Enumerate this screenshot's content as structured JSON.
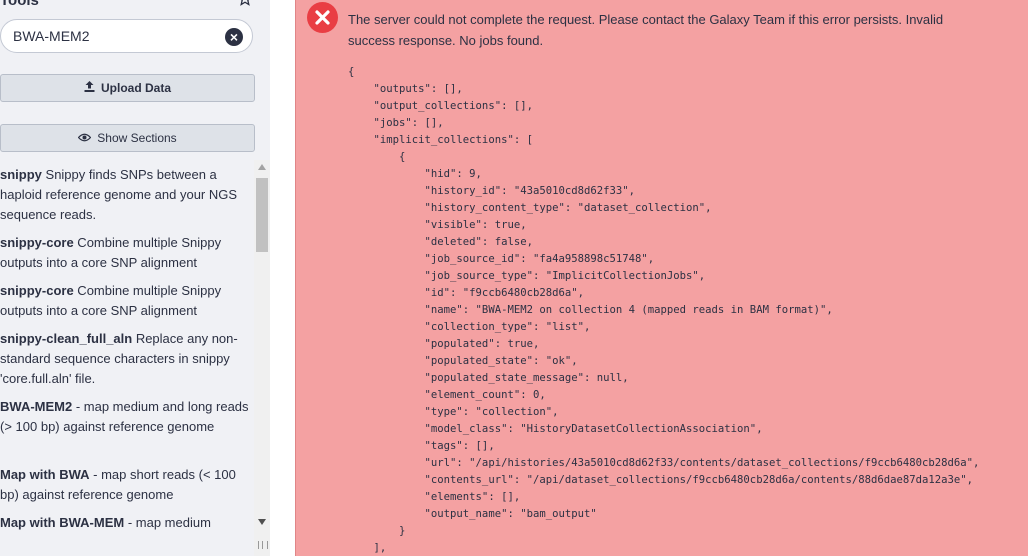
{
  "tool_panel": {
    "title": "Tools",
    "star_icon": "star-outline-icon",
    "search": {
      "value": "BWA-MEM2",
      "clear_icon": "clear-circle-icon"
    },
    "upload_label": "Upload Data",
    "upload_icon": "upload-icon",
    "sections_label": "Show Sections",
    "sections_icon": "eye-icon",
    "tools": [
      {
        "name": "snippy",
        "desc": " Snippy finds SNPs between a haploid reference genome and your NGS sequence reads."
      },
      {
        "name": "snippy-core",
        "desc": " Combine multiple Snippy outputs into a core SNP alignment"
      },
      {
        "name": "snippy-core",
        "desc": " Combine multiple Snippy outputs into a core SNP alignment"
      },
      {
        "name": "snippy-clean_full_aln",
        "desc": " Replace any non-standard sequence characters in snippy 'core.full.aln' file."
      },
      {
        "name": "BWA-MEM2",
        "desc": " - map medium and long reads (> 100 bp) against reference genome"
      },
      {
        "name": "Map with BWA",
        "desc": " - map short reads (< 100 bp) against reference genome"
      },
      {
        "name": "Map with BWA-MEM",
        "desc": " - map medium"
      }
    ]
  },
  "error": {
    "icon": "error-x-circle-icon",
    "color": "#f4a1a2",
    "message": "The server could not complete the request. Please contact the Galaxy Team if this error persists. Invalid success response. No jobs found.",
    "json_lines": [
      "{",
      "    \"outputs\": [],",
      "    \"output_collections\": [],",
      "    \"jobs\": [],",
      "    \"implicit_collections\": [",
      "        {",
      "            \"hid\": 9,",
      "            \"history_id\": \"43a5010cd8d62f33\",",
      "            \"history_content_type\": \"dataset_collection\",",
      "            \"visible\": true,",
      "            \"deleted\": false,",
      "            \"job_source_id\": \"fa4a958898c51748\",",
      "            \"job_source_type\": \"ImplicitCollectionJobs\",",
      "            \"id\": \"f9ccb6480cb28d6a\",",
      "            \"name\": \"BWA-MEM2 on collection 4 (mapped reads in BAM format)\",",
      "            \"collection_type\": \"list\",",
      "            \"populated\": true,",
      "            \"populated_state\": \"ok\",",
      "            \"populated_state_message\": null,",
      "            \"element_count\": 0,",
      "            \"type\": \"collection\",",
      "            \"model_class\": \"HistoryDatasetCollectionAssociation\",",
      "            \"tags\": [],",
      "            \"url\": \"/api/histories/43a5010cd8d62f33/contents/dataset_collections/f9ccb6480cb28d6a\",",
      "            \"contents_url\": \"/api/dataset_collections/f9ccb6480cb28d6a/contents/88d6dae87da12a3e\",",
      "            \"elements\": [],",
      "            \"output_name\": \"bam_output\"",
      "        }",
      "    ],"
    ]
  }
}
